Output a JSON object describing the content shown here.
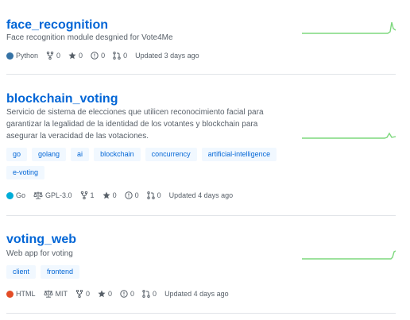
{
  "repos": [
    {
      "name": "face_recognition",
      "description": "Face recognition module desgnied for Vote4Me",
      "topics": [],
      "language": "Python",
      "language_color": "#3572A5",
      "license": "",
      "forks": "0",
      "stars": "0",
      "issues": "0",
      "pulls": "0",
      "updated": "Updated 3 days ago"
    },
    {
      "name": "blockchain_voting",
      "description": "Servicio de sistema de elecciones que utilicen reconocimiento facial para garantizar la legalidad de la identidad de los votantes y blockchain para asegurar la veracidad de las votaciones.",
      "topics": [
        "go",
        "golang",
        "ai",
        "blockchain",
        "concurrency",
        "artificial-intelligence",
        "e-voting"
      ],
      "language": "Go",
      "language_color": "#00ADD8",
      "license": "GPL-3.0",
      "forks": "1",
      "stars": "0",
      "issues": "0",
      "pulls": "0",
      "updated": "Updated 4 days ago"
    },
    {
      "name": "voting_web",
      "description": "Web app for voting",
      "topics": [
        "client",
        "frontend"
      ],
      "language": "HTML",
      "language_color": "#e34c26",
      "license": "MIT",
      "forks": "0",
      "stars": "0",
      "issues": "0",
      "pulls": "0",
      "updated": "Updated 4 days ago"
    }
  ],
  "colors": {
    "link": "#0366d6",
    "topic_bg": "#f1f8ff",
    "spark": "#7dd87d"
  }
}
